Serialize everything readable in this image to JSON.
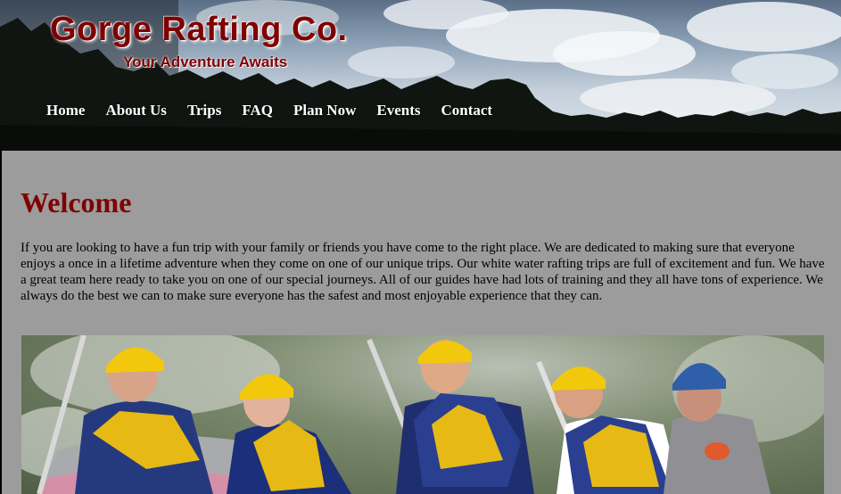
{
  "site": {
    "title": "Gorge Rafting Co.",
    "tagline": "Your Adventure Awaits"
  },
  "nav": {
    "items": [
      {
        "label": "Home"
      },
      {
        "label": "About Us"
      },
      {
        "label": "Trips"
      },
      {
        "label": "FAQ"
      },
      {
        "label": "Plan Now"
      },
      {
        "label": "Events"
      },
      {
        "label": "Contact"
      }
    ]
  },
  "main": {
    "heading": "Welcome",
    "intro": "If you are looking to have a fun trip with your family or friends you have come to the right place. We are dedicated to making sure that everyone enjoys a once in a lifetime adventure when they come on one of our unique trips. Our white water rafting trips are full of excitement and fun. We have a great team here ready to take you on one of our special journeys. All of our guides have had lots of training and they all have tons of experience. We always do the best we can to make sure everyone has the safest and most enjoyable experience that they can."
  },
  "colors": {
    "brand": "#800000",
    "page_background": "#9c9c9c",
    "nav_text": "#ffffff"
  }
}
